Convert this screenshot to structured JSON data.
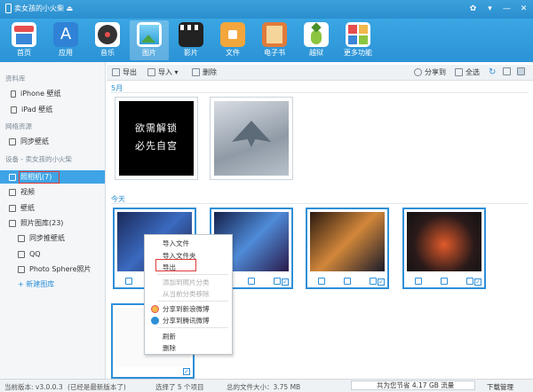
{
  "titlebar": {
    "device_name": "卖女孩的小火柴 ⏏"
  },
  "nav": [
    {
      "label": "首页",
      "icon": "home-icon",
      "color": "#e84e4e"
    },
    {
      "label": "应用",
      "icon": "app-store-icon",
      "color": "#3a86d8"
    },
    {
      "label": "音乐",
      "icon": "music-icon",
      "color": "#333333"
    },
    {
      "label": "图片",
      "icon": "photos-icon",
      "color": "#5cc0e8"
    },
    {
      "label": "影片",
      "icon": "movie-icon",
      "color": "#222222"
    },
    {
      "label": "文件",
      "icon": "folder-icon",
      "color": "#f3a63c"
    },
    {
      "label": "电子书",
      "icon": "ebook-icon",
      "color": "#e07b3a"
    },
    {
      "label": "越狱",
      "icon": "pineapple-icon",
      "color": "#8cc63f"
    },
    {
      "label": "更多功能",
      "icon": "more-icon",
      "color": "#f2b84b"
    }
  ],
  "sidebar": {
    "sec_library": "资料库",
    "iphone": "iPhone 壁纸",
    "ipad": "iPad 壁纸",
    "sec_network": "网络资源",
    "sync_wallpaper": "同步壁纸",
    "sec_device": "设备 - 卖女孩的小火柴",
    "camera": "照相机(7)",
    "video": "视频",
    "wallpaper": "壁纸",
    "gallery": "照片图库(23)",
    "sync_push": "同步推壁纸",
    "qq": "QQ",
    "sphere": "Photo Sphere照片",
    "new_gallery": "+ 新建图库"
  },
  "actionbar": {
    "export": "导出",
    "import": "导入 ▾",
    "delete": "删除",
    "share": "分享到",
    "select_all": "全选"
  },
  "content": {
    "may_label": "5月",
    "today_label": "今天",
    "meme_line1": "欲需解锁",
    "meme_line2": "必先自宫"
  },
  "context_menu": {
    "import_file": "导入文件",
    "import_folder": "导入文件夹",
    "export": "导出",
    "add_to_album": "添加到照片分类",
    "remove_from_album": "从当前分类移除",
    "share_weibo": "分享到新浪微博",
    "share_tencent": "分享到腾讯微博",
    "refresh": "刷新",
    "delete": "删除"
  },
  "statusbar": {
    "version": "当前版本: v3.0.0.3",
    "latest": "(已经是最新版本了)",
    "selected": "选择了 5 个项目",
    "total_size": "总的文件大小：3.75 MB",
    "savings": "共为您节省 4.17 GB 流量",
    "download_mgr": "下载管理"
  },
  "colors": {
    "accent": "#2e8fd8",
    "highlight_box": "#e23a3a"
  }
}
